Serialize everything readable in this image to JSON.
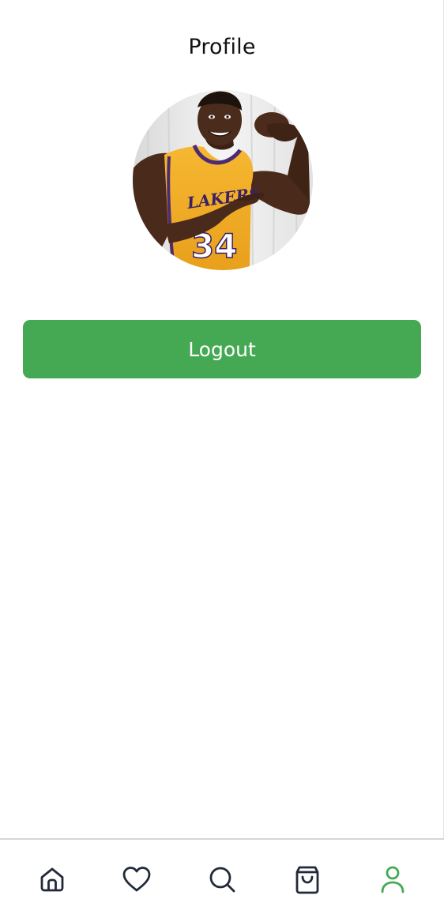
{
  "header": {
    "title": "Profile"
  },
  "profile": {
    "avatar_icon": "user-avatar-photo",
    "jersey_text": "LAKERS",
    "jersey_number": "34"
  },
  "actions": {
    "logout_label": "Logout"
  },
  "colors": {
    "accent": "#45A954",
    "icon_default": "#222A3A",
    "icon_active": "#45A954",
    "divider": "#D6D6D6"
  },
  "tabbar": {
    "items": [
      {
        "id": "home",
        "icon": "home-icon",
        "active": false
      },
      {
        "id": "favorites",
        "icon": "heart-icon",
        "active": false
      },
      {
        "id": "search",
        "icon": "search-icon",
        "active": false
      },
      {
        "id": "cart",
        "icon": "shopping-bag-icon",
        "active": false
      },
      {
        "id": "profile",
        "icon": "user-icon",
        "active": true
      }
    ]
  }
}
